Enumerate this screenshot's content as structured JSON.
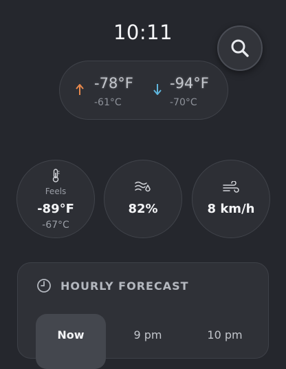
{
  "clock": {
    "time": "10:11"
  },
  "search": {
    "icon": "search-icon"
  },
  "high_low": {
    "high_f": "-78°F",
    "high_c": "-61°C",
    "low_f": "-94°F",
    "low_c": "-70°C",
    "high_color": "#e8894d",
    "low_color": "#5fb6dd"
  },
  "metrics": {
    "feels": {
      "icon": "thermometer-icon",
      "label": "Feels",
      "value": "-89°F",
      "sub": "-67°C"
    },
    "humidity": {
      "icon": "humidity-icon",
      "value": "82%"
    },
    "wind": {
      "icon": "wind-icon",
      "value": "8 km/h"
    }
  },
  "hourly": {
    "title": "HOURLY FORECAST",
    "icon": "clock-icon",
    "hours": [
      {
        "label": "Now",
        "active": true
      },
      {
        "label": "9 pm",
        "active": false
      },
      {
        "label": "10 pm",
        "active": false
      }
    ]
  }
}
